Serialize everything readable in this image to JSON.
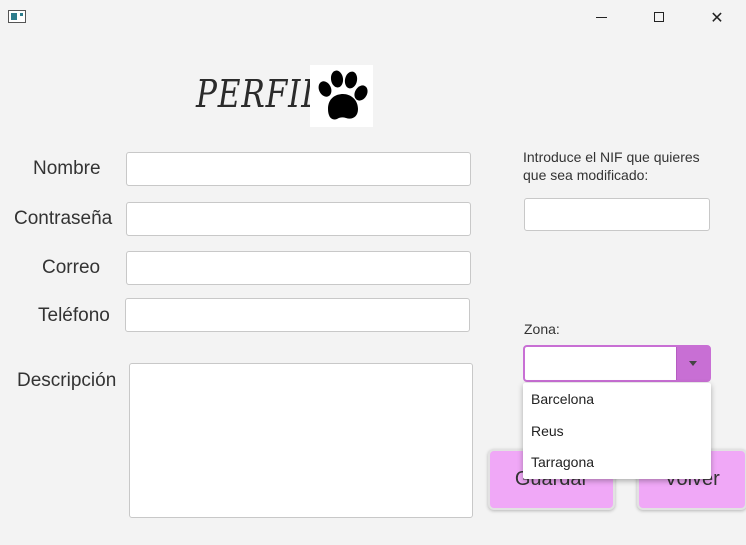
{
  "window": {
    "minimize_glyph": "",
    "close_glyph": "✕"
  },
  "header": {
    "title": "PERFIL"
  },
  "form": {
    "name_label": "Nombre",
    "password_label": "Contraseña",
    "email_label": "Correo",
    "phone_label": "Teléfono",
    "description_label": "Descripción",
    "name_value": "",
    "password_value": "",
    "email_value": "",
    "phone_value": "",
    "description_value": ""
  },
  "nif": {
    "instruction": "Introduce el NIF que quieres que sea modificado:",
    "value": ""
  },
  "zone": {
    "label": "Zona:",
    "selected": "",
    "options": [
      "Barcelona",
      "Reus",
      "Tarragona"
    ]
  },
  "buttons": {
    "save": "Guardar",
    "back": "Volver"
  },
  "colors": {
    "accent": "#c86fd4",
    "button": "#f0a8f7",
    "background": "#f3f3f3"
  }
}
